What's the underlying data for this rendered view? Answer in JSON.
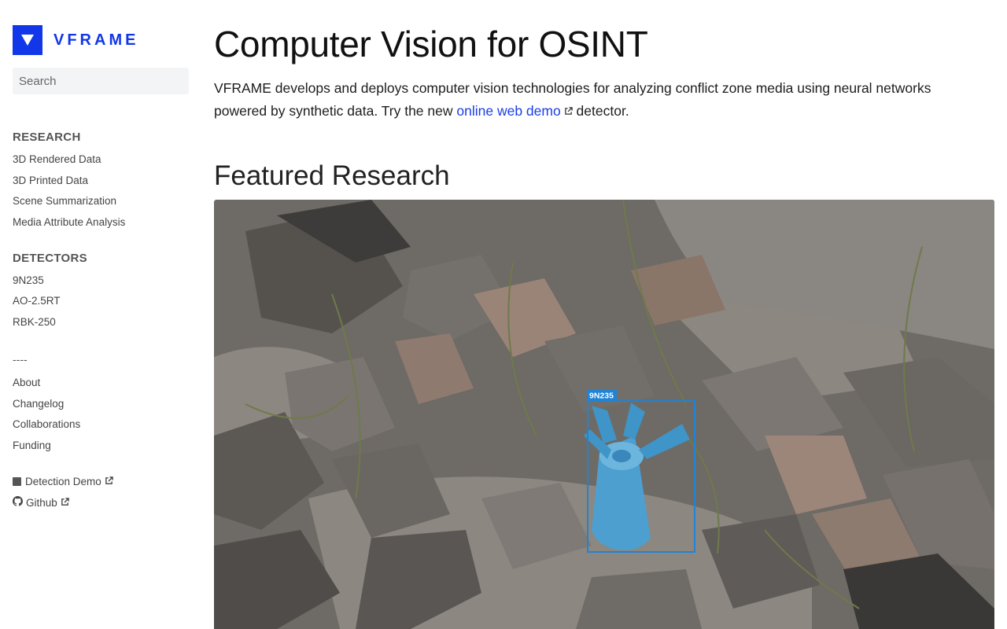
{
  "brand": {
    "name": "VFRAME",
    "color": "#1237e8",
    "icon": "triangle-down-logo-icon"
  },
  "search": {
    "placeholder": "Search"
  },
  "nav": {
    "research": {
      "heading": "RESEARCH",
      "items": [
        "3D Rendered Data",
        "3D Printed Data",
        "Scene Summarization",
        "Media Attribute Analysis"
      ]
    },
    "detectors": {
      "heading": "DETECTORS",
      "items": [
        "9N235",
        "AO-2.5RT",
        "RBK-250"
      ]
    },
    "divider": "----",
    "info": {
      "items": [
        "About",
        "Changelog",
        "Collaborations",
        "Funding"
      ]
    },
    "external": [
      {
        "label": "Detection Demo",
        "icon": "square-icon"
      },
      {
        "label": "Github",
        "icon": "github-icon"
      }
    ]
  },
  "main": {
    "title": "Computer Vision for OSINT",
    "intro_before": "VFRAME develops and deploys computer vision technologies for analyzing conflict zone media using neural networks powered by synthetic data. Try the new ",
    "intro_link": "online web demo",
    "intro_after": " detector.",
    "link_color": "#1a3de6",
    "section_title": "Featured Research",
    "featured": {
      "detection_label": "9N235",
      "box_color": "#1f83d6"
    }
  }
}
